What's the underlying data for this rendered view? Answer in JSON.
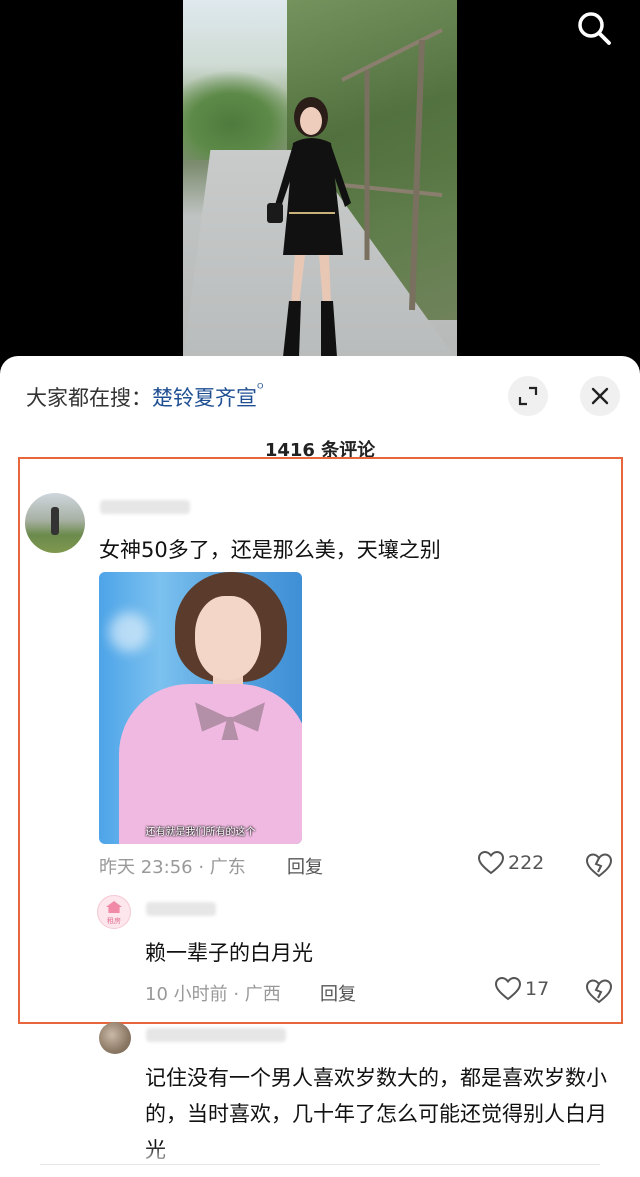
{
  "search_bar": {
    "prefix": "大家都在搜：",
    "keyword": "楚铃夏齐宣",
    "search_glyph": "ᴼ"
  },
  "icons": {
    "top_search": "search-icon",
    "expand": "expand-icon",
    "close": "close-icon",
    "like": "heart-icon",
    "dislike": "broken-heart-icon"
  },
  "comments_header": {
    "count_label": "1416 条评论"
  },
  "comments": [
    {
      "text": "女神50多了，还是那么美，天壤之别",
      "image_subtitle": "还有就是我们所有的这个",
      "time": "昨天 23:56 · 广东",
      "reply_label": "回复",
      "likes": "222"
    },
    {
      "avatar_text": "租房",
      "text": "赖一辈子的白月光",
      "time": "10 小时前 · 广西",
      "reply_label": "回复",
      "likes": "17"
    },
    {
      "text": "记住没有一个男人喜欢岁数大的，都是喜欢岁数小的，当时喜欢，几十年了怎么可能还觉得别人白月光"
    }
  ],
  "colors": {
    "highlight_border": "#e8663b",
    "keyword_blue": "#1f4f93",
    "meta_gray": "#999999"
  }
}
